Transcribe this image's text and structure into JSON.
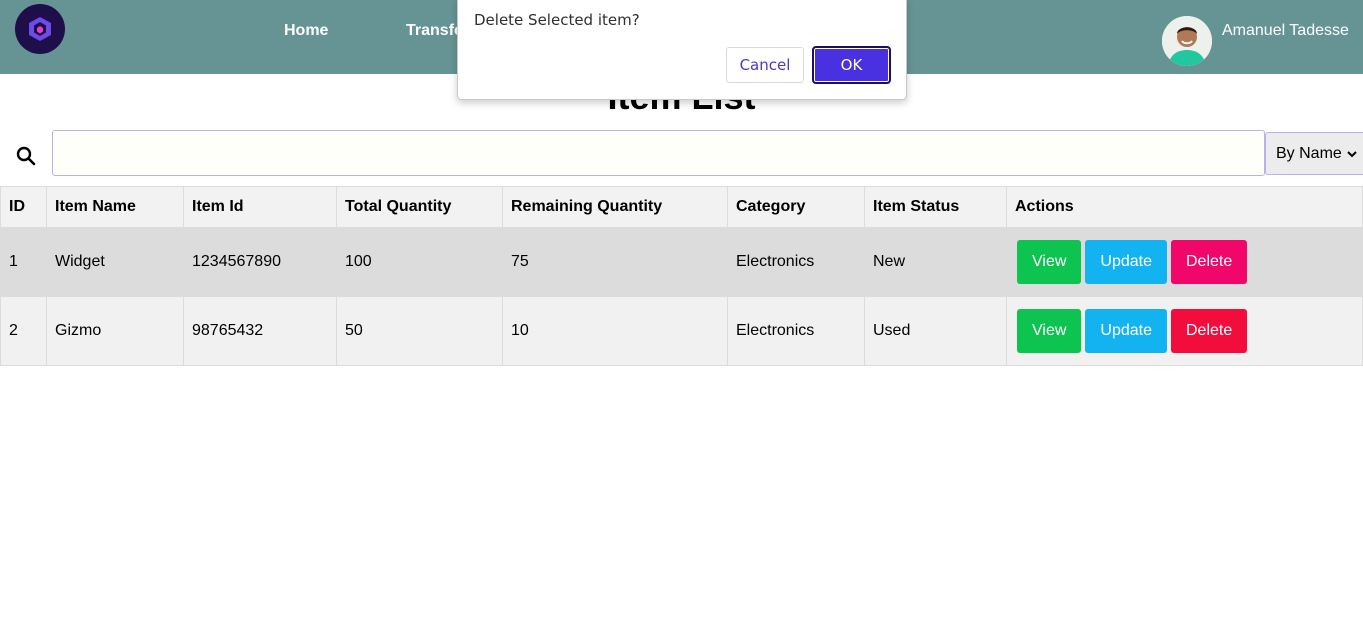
{
  "nav": {
    "links": [
      "Home",
      "Transfer"
    ],
    "user_name": "Amanuel Tadesse"
  },
  "main": {
    "title": "Item List",
    "search": {
      "value": "",
      "placeholder": ""
    },
    "sort": {
      "selected": "By Name"
    }
  },
  "table": {
    "headers": [
      "ID",
      "Item Name",
      "Item Id",
      "Total Quantity",
      "Remaining Quantity",
      "Category",
      "Item Status",
      "Actions"
    ],
    "rows": [
      {
        "id": "1",
        "name": "Widget",
        "item_id": "1234567890",
        "total": "100",
        "remaining": "75",
        "category": "Electronics",
        "status": "New"
      },
      {
        "id": "2",
        "name": "Gizmo",
        "item_id": "98765432",
        "total": "50",
        "remaining": "10",
        "category": "Electronics",
        "status": "Used"
      }
    ],
    "actions": {
      "view": "View",
      "update": "Update",
      "delete": "Delete"
    }
  },
  "dialog": {
    "message": "Delete Selected item?",
    "cancel": "Cancel",
    "ok": "OK"
  },
  "colors": {
    "navbar": "#669494",
    "view": "#0cc44f",
    "update": "#13b3f2",
    "delete": "#f10669",
    "ok_button": "#4930e0"
  },
  "icons": [
    "app-logo-icon",
    "search-icon",
    "user-avatar",
    "chevron-down-icon"
  ]
}
